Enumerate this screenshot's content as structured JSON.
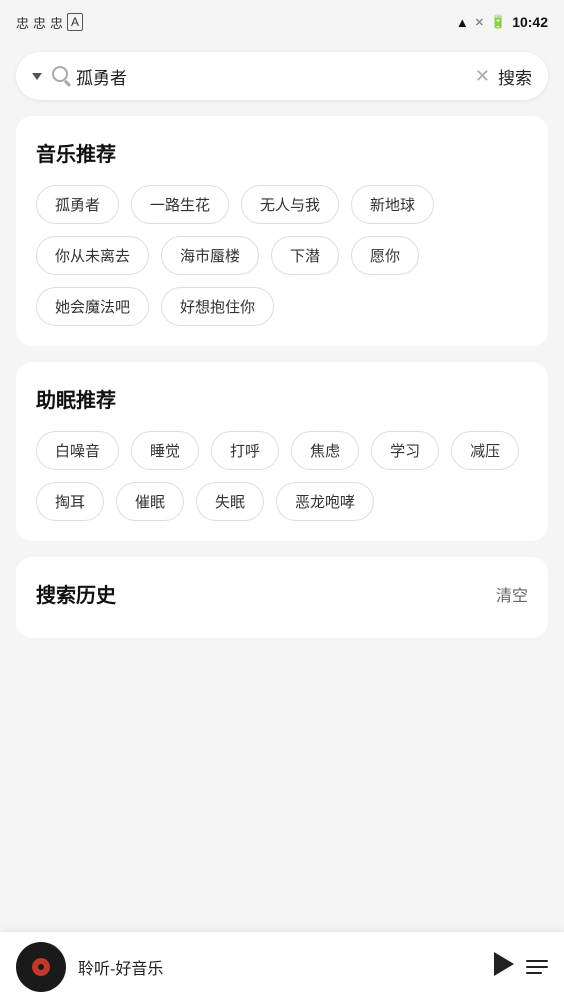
{
  "statusBar": {
    "time": "10:42",
    "icons": [
      "忠",
      "忠",
      "忠",
      "A"
    ]
  },
  "searchBar": {
    "query": "孤勇者",
    "buttonLabel": "搜索",
    "dropdownIcon": "chevron-down",
    "searchIcon": "magnify",
    "clearIcon": "x"
  },
  "musicSection": {
    "title": "音乐推荐",
    "tags": [
      "孤勇者",
      "一路生花",
      "无人与我",
      "新地球",
      "你从未离去",
      "海市蜃楼",
      "下潜",
      "愿你",
      "她会魔法吧",
      "好想抱住你"
    ]
  },
  "sleepSection": {
    "title": "助眠推荐",
    "tags": [
      "白噪音",
      "睡觉",
      "打呼",
      "焦虑",
      "学习",
      "减压",
      "掏耳",
      "催眠",
      "失眠",
      "恶龙咆哮"
    ]
  },
  "historySection": {
    "title": "搜索历史",
    "clearLabel": "清空"
  },
  "player": {
    "title": "聆听-好音乐"
  }
}
